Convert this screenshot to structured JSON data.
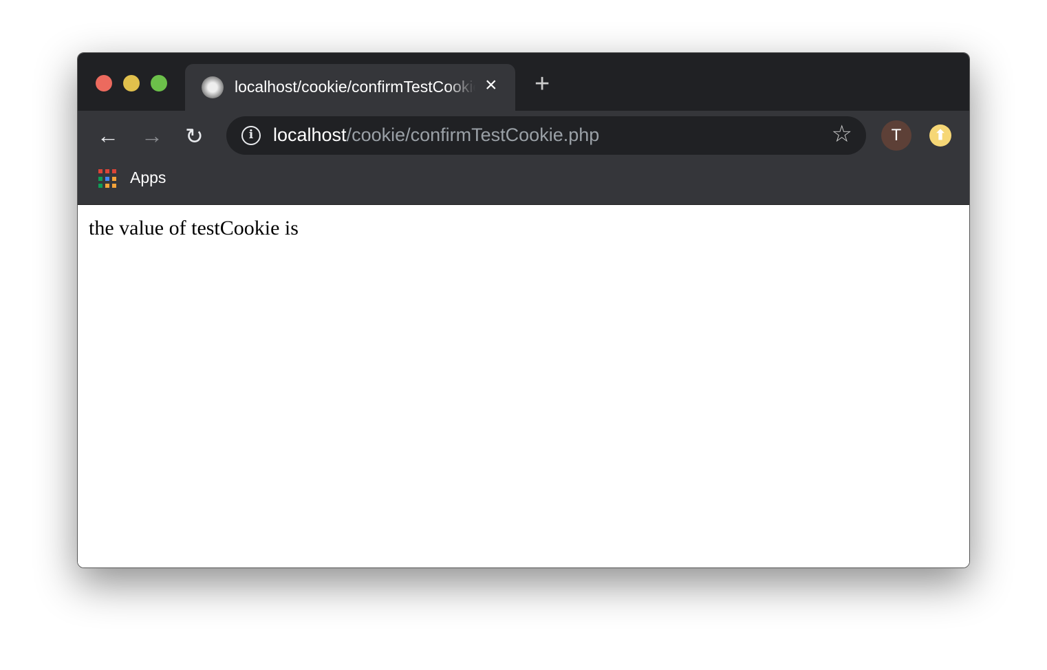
{
  "window": {
    "controls": {
      "close_color": "#ec6a5e",
      "minimize_color": "#e1c04c",
      "maximize_color": "#6cc04a"
    }
  },
  "tab": {
    "title": "localhost/cookie/confirmTestCookie.php",
    "close_icon": "×"
  },
  "new_tab_icon": "+",
  "toolbar": {
    "back_icon": "←",
    "forward_icon": "→",
    "reload_icon": "↻",
    "url_host": "localhost",
    "url_path": "/cookie/confirmTestCookie.php",
    "star_icon": "☆",
    "avatar_letter": "T",
    "update_icon": "⬆"
  },
  "bookmarks": {
    "apps_label": "Apps",
    "apps_colors": [
      "#db4437",
      "#db4437",
      "#db4437",
      "#0f9d58",
      "#4285f4",
      "#f4a33a",
      "#0f9d58",
      "#f4a33a",
      "#f4a33a"
    ]
  },
  "page": {
    "text": "the value of testCookie is"
  }
}
